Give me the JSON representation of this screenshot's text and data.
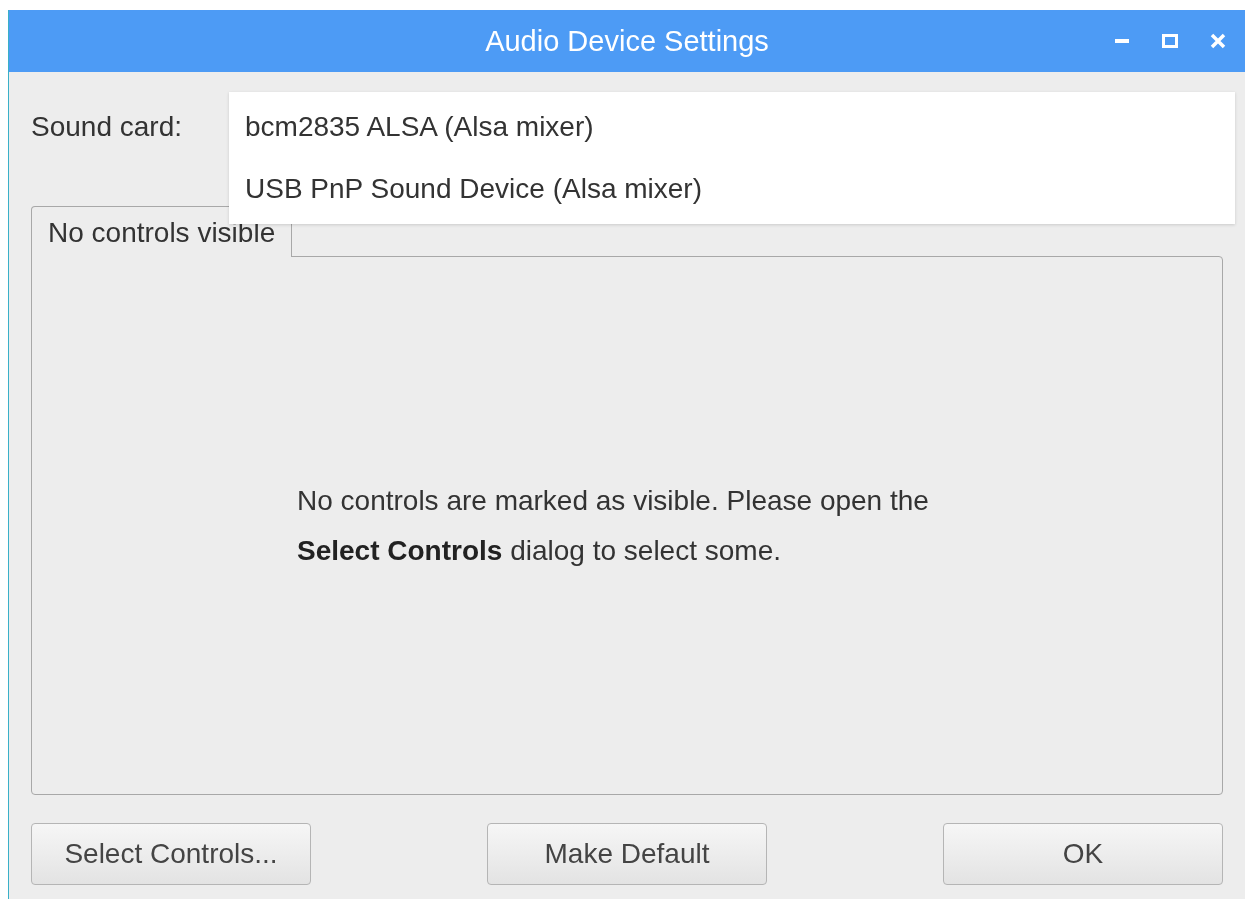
{
  "window": {
    "title": "Audio Device Settings",
    "controls": [
      {
        "kind": "minimize"
      },
      {
        "kind": "maximize"
      },
      {
        "kind": "close"
      }
    ]
  },
  "sound_card": {
    "label": "Sound card:",
    "options": [
      {
        "label": "bcm2835 ALSA (Alsa mixer)",
        "selected": false
      },
      {
        "label": "USB PnP Sound Device (Alsa mixer)",
        "selected": false
      }
    ]
  },
  "tabs": [
    {
      "label": "No controls visible",
      "selected": true
    }
  ],
  "message": "No controls are marked as visible. Please open the **Select Controls** dialog to select some.",
  "buttons": [
    "Select Controls...",
    "Make Default",
    "OK"
  ]
}
